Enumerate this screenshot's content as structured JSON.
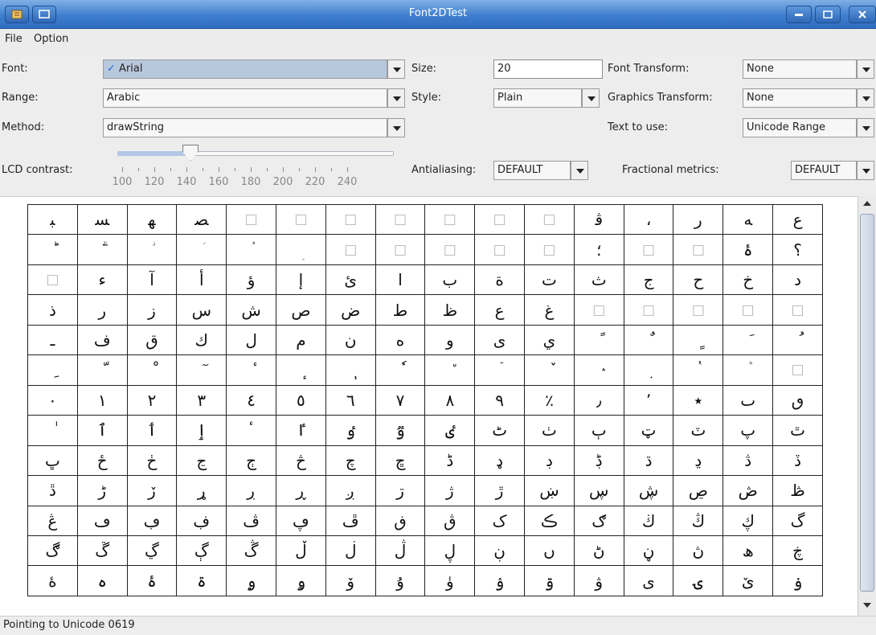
{
  "window": {
    "title": "Font2DTest"
  },
  "menu": {
    "file": "File",
    "option": "Option"
  },
  "controls": {
    "font_label": "Font:",
    "font_value": "Arial",
    "font_check": "✓",
    "size_label": "Size:",
    "size_value": "20",
    "font_transform_label": "Font Transform:",
    "font_transform_value": "None",
    "range_label": "Range:",
    "range_value": "Arabic",
    "style_label": "Style:",
    "style_value": "Plain",
    "graphics_transform_label": "Graphics Transform:",
    "graphics_transform_value": "None",
    "method_label": "Method:",
    "method_value": "drawString",
    "text_to_use_label": "Text to use:",
    "text_to_use_value": "Unicode Range",
    "lcd_label": "LCD contrast:",
    "lcd_value": 140,
    "lcd_ticks": [
      "100",
      "120",
      "140",
      "160",
      "180",
      "200",
      "220",
      "240"
    ],
    "antialiasing_label": "Antialiasing:",
    "antialiasing_value": "DEFAULT",
    "fractional_label": "Fractional metrics:",
    "fractional_value": "DEFAULT"
  },
  "glyph_grid": [
    [
      "ﺒ",
      "ﺴ",
      "ﻬ",
      "ﺼ",
      "□",
      "□",
      "□",
      "□",
      "□",
      "□",
      "□",
      "ﭬ",
      "،",
      "ﺭ",
      "ﻪ",
      "ﻉ"
    ],
    [
      "ؕ",
      "ؖ",
      "ؗ",
      "ؘ",
      "ؙ",
      "ؚ",
      "□",
      "□",
      "□",
      "□",
      "□",
      "؛",
      "□",
      "□",
      "ۂ",
      "؟"
    ],
    [
      "□",
      "ء",
      "آ",
      "أ",
      "ؤ",
      "إ",
      "ئ",
      "ا",
      "ب",
      "ة",
      "ت",
      "ث",
      "ج",
      "ح",
      "خ",
      "د"
    ],
    [
      "ذ",
      "ر",
      "ز",
      "س",
      "ش",
      "ص",
      "ض",
      "ط",
      "ظ",
      "ع",
      "غ",
      "□",
      "□",
      "□",
      "□",
      "□"
    ],
    [
      "ـ",
      "ف",
      "ق",
      "ك",
      "ل",
      "م",
      "ن",
      "ه",
      "و",
      "ى",
      "ي",
      "ً",
      "ٌ",
      "ٍ",
      "َ",
      "ُ"
    ],
    [
      "ِ",
      "ّ",
      "ْ",
      "ٓ",
      "ٔ",
      "ٕ",
      "ٖ",
      "ٗ",
      "٘",
      "ٙ",
      "ٚ",
      "ٛ",
      "ٜ",
      "ٝ",
      "ٞ",
      "□"
    ],
    [
      "٠",
      "١",
      "٢",
      "٣",
      "٤",
      "٥",
      "٦",
      "٧",
      "٨",
      "٩",
      "٪",
      "٫",
      "٬",
      "٭",
      "ٮ",
      "ٯ"
    ],
    [
      "ٰ",
      "ٱ",
      "ٲ",
      "ٳ",
      "ٴ",
      "ٵ",
      "ٶ",
      "ٷ",
      "ٸ",
      "ٹ",
      "ٺ",
      "ٻ",
      "ټ",
      "ٽ",
      "پ",
      "ٿ"
    ],
    [
      "ڀ",
      "ځ",
      "ڂ",
      "ڃ",
      "ڄ",
      "څ",
      "چ",
      "ڇ",
      "ڈ",
      "ډ",
      "ڊ",
      "ڋ",
      "ڌ",
      "ڍ",
      "ڎ",
      "ڏ"
    ],
    [
      "ڐ",
      "ڑ",
      "ڒ",
      "ړ",
      "ڔ",
      "ڕ",
      "ږ",
      "ڗ",
      "ژ",
      "ڙ",
      "ښ",
      "ڛ",
      "ڜ",
      "ڝ",
      "ڞ",
      "ڟ"
    ],
    [
      "ڠ",
      "ڡ",
      "ڢ",
      "ڣ",
      "ڤ",
      "ڥ",
      "ڦ",
      "ڧ",
      "ڨ",
      "ک",
      "ڪ",
      "ګ",
      "ڬ",
      "ڭ",
      "ڮ",
      "گ"
    ],
    [
      "ڰ",
      "ڱ",
      "ڲ",
      "ڳ",
      "ڴ",
      "ڵ",
      "ڶ",
      "ڷ",
      "ڸ",
      "ڹ",
      "ں",
      "ڻ",
      "ڼ",
      "ڽ",
      "ھ",
      "ڿ"
    ],
    [
      "ۀ",
      "ہ",
      "ۂ",
      "ۃ",
      "ۄ",
      "ۅ",
      "ۆ",
      "ۇ",
      "ۈ",
      "ۉ",
      "ۊ",
      "ۋ",
      "ی",
      "ۍ",
      "ێ",
      "ۏ"
    ]
  ],
  "status": "Pointing to Unicode 0619"
}
